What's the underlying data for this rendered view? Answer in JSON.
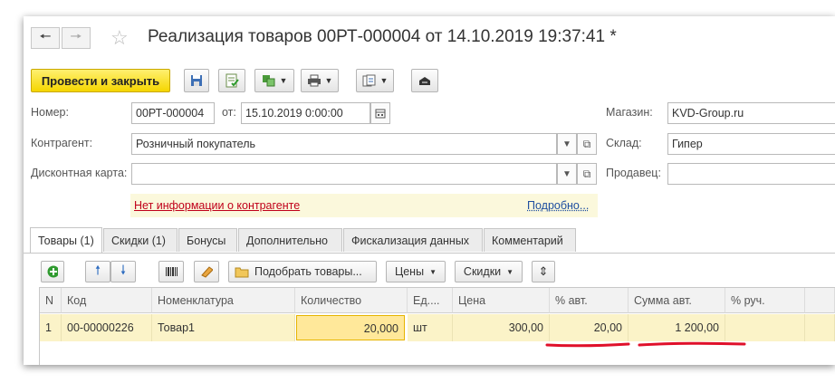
{
  "nav": {
    "back_icon": "arrow-left-icon",
    "forward_icon": "arrow-right-icon"
  },
  "title": "Реализация товаров 00РТ-000004 от 14.10.2019 19:37:41 *",
  "toolbar": {
    "post_close_label": "Провести и закрыть",
    "icons": [
      "save-icon",
      "post-icon",
      "create-based-on-icon",
      "print-icon",
      "reports-icon",
      "cash-register-icon"
    ]
  },
  "form": {
    "number_label": "Номер:",
    "number_value": "00РТ-000004",
    "date_label": "от:",
    "date_value": "15.10.2019  0:00:00",
    "store_label": "Магазин:",
    "store_value": "KVD-Group.ru",
    "counterparty_label": "Контрагент:",
    "counterparty_value": "Розничный покупатель",
    "warehouse_label": "Склад:",
    "warehouse_value": "Гипер",
    "discount_card_label": "Дисконтная карта:",
    "discount_card_value": "",
    "seller_label": "Продавец:",
    "seller_value": "",
    "info_link": "Нет информации о контрагенте",
    "details_link": "Подробно..."
  },
  "tabs": [
    "Товары (1)",
    "Скидки (1)",
    "Бонусы",
    "Дополнительно",
    "Фискализация данных",
    "Комментарий"
  ],
  "table_toolbar": {
    "select_goods_label": "Подобрать товары...",
    "prices_label": "Цены",
    "discounts_label": "Скидки"
  },
  "table": {
    "headers": [
      "N",
      "Код",
      "Номенклатура",
      "Количество",
      "Ед....",
      "Цена",
      "% авт.",
      "Сумма авт.",
      "% руч."
    ],
    "rows": [
      [
        "1",
        "00-00000226",
        "Товар1",
        "20,000",
        "шт",
        "300,00",
        "20,00",
        "1 200,00",
        ""
      ]
    ]
  },
  "colors": {
    "accent_yellow": "#f5d600",
    "link_red": "#c0001a",
    "link_blue": "#1f4fa0",
    "underline_red": "#e0102a"
  }
}
